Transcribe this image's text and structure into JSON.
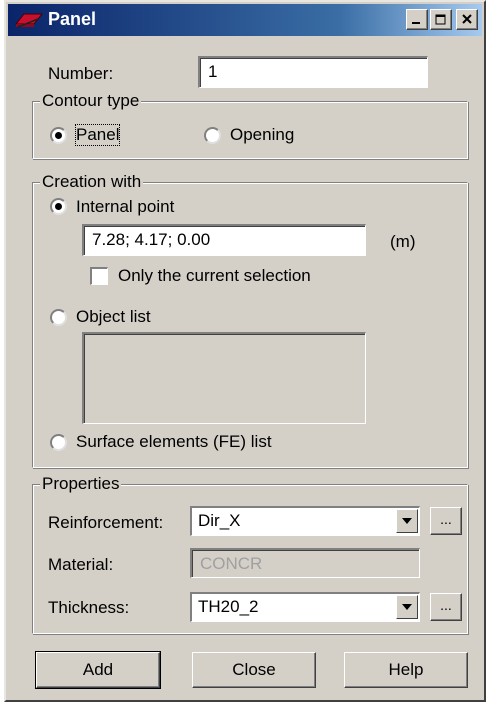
{
  "window": {
    "title": "Panel"
  },
  "titlebar_buttons": [
    "minimize-icon",
    "maximize-icon",
    "close-icon"
  ],
  "number": {
    "label": "Number:",
    "value": "1"
  },
  "contour_type": {
    "title": "Contour type",
    "options": [
      {
        "label": "Panel",
        "selected": true
      },
      {
        "label": "Opening",
        "selected": false
      }
    ]
  },
  "creation_with": {
    "title": "Creation with",
    "internal_point": {
      "label": "Internal point",
      "selected": true,
      "value": "7.28; 4.17; 0.00",
      "unit": "(m)"
    },
    "only_current_selection": {
      "label": "Only the current selection",
      "checked": false
    },
    "object_list": {
      "label": "Object list",
      "selected": false
    },
    "surface_elements": {
      "label": "Surface elements (FE) list",
      "selected": false
    }
  },
  "properties": {
    "title": "Properties",
    "reinforcement": {
      "label": "Reinforcement:",
      "value": "Dir_X",
      "more": "..."
    },
    "material": {
      "label": "Material:",
      "value": "CONCR"
    },
    "thickness": {
      "label": "Thickness:",
      "value": "TH20_2",
      "more": "..."
    }
  },
  "buttons": {
    "add": "Add",
    "close": "Close",
    "help": "Help"
  }
}
